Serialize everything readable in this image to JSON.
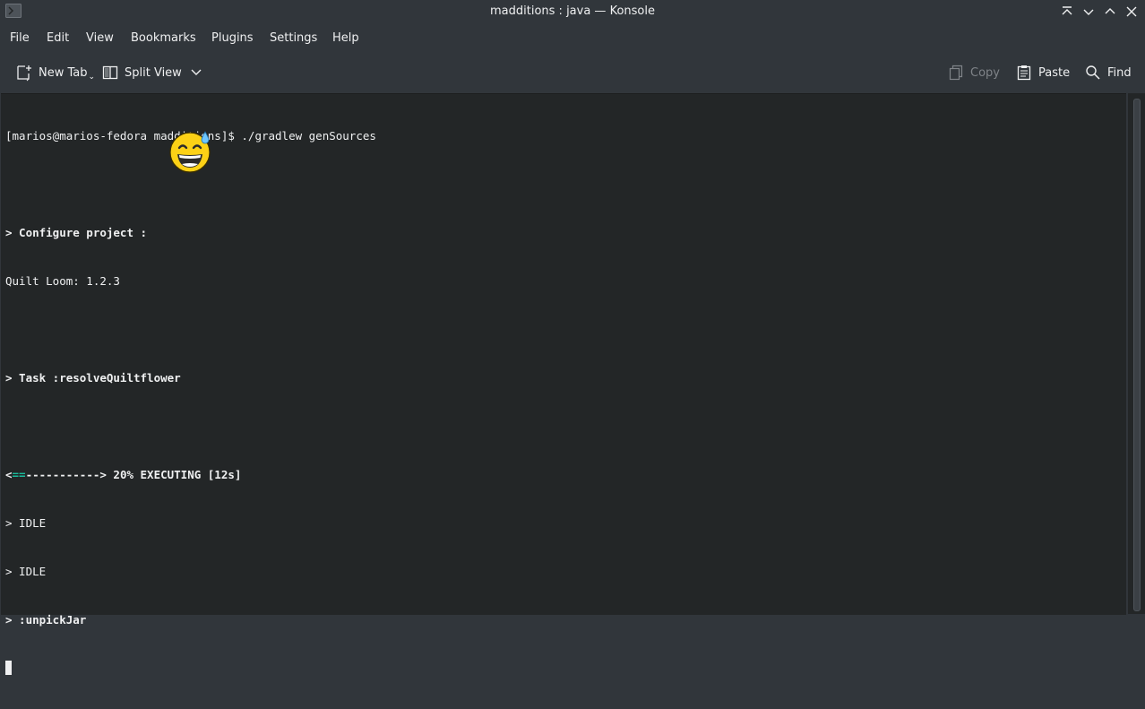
{
  "window": {
    "title": "madditions : java — Konsole"
  },
  "menu": {
    "items": [
      "File",
      "Edit",
      "View",
      "Bookmarks",
      "Plugins",
      "Settings",
      "Help"
    ]
  },
  "toolbar": {
    "new_tab": "New Tab",
    "split_view": "Split View",
    "copy": "Copy",
    "paste": "Paste",
    "find": "Find"
  },
  "terminal": {
    "prompt_line": "[marios@marios-fedora madditions]$ ./gradlew genSources",
    "configure_line": "> Configure project :",
    "loom_line": "Quilt Loom: 1.2.3",
    "task_line": "> Task :resolveQuiltflower",
    "progress_prefix": "<",
    "progress_done": "==",
    "progress_rest": "-----------> 20% EXECUTING [12s]",
    "progress_percent": 20,
    "worker1": "> IDLE",
    "worker2": "> IDLE",
    "worker3": "> :unpickJar"
  },
  "icons": {
    "app": "konsole-icon",
    "keep_above": "keep-above-icon",
    "minimize": "minimize-icon",
    "maximize": "maximize-icon",
    "close": "close-icon",
    "new_tab": "new-tab-icon",
    "split_view": "split-view-icon",
    "copy": "copy-icon",
    "paste": "paste-icon",
    "find": "search-icon",
    "emoji": "grinning-sweat-emoji"
  },
  "colors": {
    "background": "#31363b",
    "terminal_bg": "#232627",
    "text": "#eff0f1",
    "progress_green": "#1abc9c",
    "disabled": "#7f8388"
  }
}
